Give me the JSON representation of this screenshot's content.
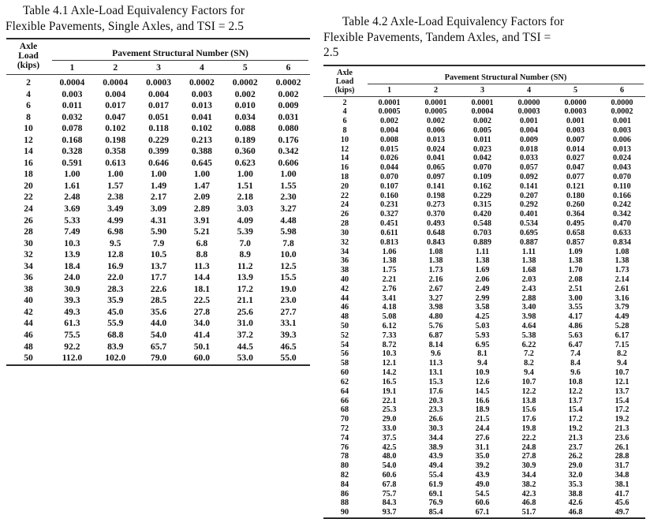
{
  "page": {
    "background_color": "#ffffff",
    "text_color": "#111111",
    "rule_color": "#2b2b2b"
  },
  "tables": [
    {
      "id": "table-4-1",
      "title_lines": [
        "Table 4.1  Axle-Load Equivalency Factors for",
        "Flexible Pavements, Single Axles, and TSI = 2.5"
      ],
      "stub_header_lines": [
        "Axle",
        "Load",
        "(kips)"
      ],
      "span_header": "Pavement Structural Number (SN)",
      "column_headers": [
        "1",
        "2",
        "3",
        "4",
        "5",
        "6"
      ],
      "rows": [
        {
          "load": "2",
          "values": [
            "0.0004",
            "0.0004",
            "0.0003",
            "0.0002",
            "0.0002",
            "0.0002"
          ]
        },
        {
          "load": "4",
          "values": [
            "0.003",
            "0.004",
            "0.004",
            "0.003",
            "0.002",
            "0.002"
          ]
        },
        {
          "load": "6",
          "values": [
            "0.011",
            "0.017",
            "0.017",
            "0.013",
            "0.010",
            "0.009"
          ]
        },
        {
          "load": "8",
          "values": [
            "0.032",
            "0.047",
            "0.051",
            "0.041",
            "0.034",
            "0.031"
          ]
        },
        {
          "load": "10",
          "values": [
            "0.078",
            "0.102",
            "0.118",
            "0.102",
            "0.088",
            "0.080"
          ]
        },
        {
          "load": "12",
          "values": [
            "0.168",
            "0.198",
            "0.229",
            "0.213",
            "0.189",
            "0.176"
          ]
        },
        {
          "load": "14",
          "values": [
            "0.328",
            "0.358",
            "0.399",
            "0.388",
            "0.360",
            "0.342"
          ]
        },
        {
          "load": "16",
          "values": [
            "0.591",
            "0.613",
            "0.646",
            "0.645",
            "0.623",
            "0.606"
          ]
        },
        {
          "load": "18",
          "values": [
            "1.00",
            "1.00",
            "1.00",
            "1.00",
            "1.00",
            "1.00"
          ]
        },
        {
          "load": "20",
          "values": [
            "1.61",
            "1.57",
            "1.49",
            "1.47",
            "1.51",
            "1.55"
          ]
        },
        {
          "load": "22",
          "values": [
            "2.48",
            "2.38",
            "2.17",
            "2.09",
            "2.18",
            "2.30"
          ]
        },
        {
          "load": "24",
          "values": [
            "3.69",
            "3.49",
            "3.09",
            "2.89",
            "3.03",
            "3.27"
          ]
        },
        {
          "load": "26",
          "values": [
            "5.33",
            "4.99",
            "4.31",
            "3.91",
            "4.09",
            "4.48"
          ]
        },
        {
          "load": "28",
          "values": [
            "7.49",
            "6.98",
            "5.90",
            "5.21",
            "5.39",
            "5.98"
          ]
        },
        {
          "load": "30",
          "values": [
            "10.3",
            "9.5",
            "7.9",
            "6.8",
            "7.0",
            "7.8"
          ]
        },
        {
          "load": "32",
          "values": [
            "13.9",
            "12.8",
            "10.5",
            "8.8",
            "8.9",
            "10.0"
          ]
        },
        {
          "load": "34",
          "values": [
            "18.4",
            "16.9",
            "13.7",
            "11.3",
            "11.2",
            "12.5"
          ]
        },
        {
          "load": "36",
          "values": [
            "24.0",
            "22.0",
            "17.7",
            "14.4",
            "13.9",
            "15.5"
          ]
        },
        {
          "load": "38",
          "values": [
            "30.9",
            "28.3",
            "22.6",
            "18.1",
            "17.2",
            "19.0"
          ]
        },
        {
          "load": "40",
          "values": [
            "39.3",
            "35.9",
            "28.5",
            "22.5",
            "21.1",
            "23.0"
          ]
        },
        {
          "load": "42",
          "values": [
            "49.3",
            "45.0",
            "35.6",
            "27.8",
            "25.6",
            "27.7"
          ]
        },
        {
          "load": "44",
          "values": [
            "61.3",
            "55.9",
            "44.0",
            "34.0",
            "31.0",
            "33.1"
          ]
        },
        {
          "load": "46",
          "values": [
            "75.5",
            "68.8",
            "54.0",
            "41.4",
            "37.2",
            "39.3"
          ]
        },
        {
          "load": "48",
          "values": [
            "92.2",
            "83.9",
            "65.7",
            "50.1",
            "44.5",
            "46.5"
          ]
        },
        {
          "load": "50",
          "values": [
            "112.0",
            "102.0",
            "79.0",
            "60.0",
            "53.0",
            "55.0"
          ]
        }
      ]
    },
    {
      "id": "table-4-2",
      "title_lines": [
        "Table 4.2  Axle-Load Equivalency Factors for",
        "Flexible Pavements, Tandem Axles, and TSI =",
        "2.5"
      ],
      "stub_header_lines": [
        "Axle",
        "Load",
        "(kips)"
      ],
      "span_header": "Pavement Structural Number (SN)",
      "column_headers": [
        "1",
        "2",
        "3",
        "4",
        "5",
        "6"
      ],
      "rows": [
        {
          "load": "2",
          "values": [
            "0.0001",
            "0.0001",
            "0.0001",
            "0.0000",
            "0.0000",
            "0.0000"
          ]
        },
        {
          "load": "4",
          "values": [
            "0.0005",
            "0.0005",
            "0.0004",
            "0.0003",
            "0.0003",
            "0.0002"
          ]
        },
        {
          "load": "6",
          "values": [
            "0.002",
            "0.002",
            "0.002",
            "0.001",
            "0.001",
            "0.001"
          ]
        },
        {
          "load": "8",
          "values": [
            "0.004",
            "0.006",
            "0.005",
            "0.004",
            "0.003",
            "0.003"
          ]
        },
        {
          "load": "10",
          "values": [
            "0.008",
            "0.013",
            "0.011",
            "0.009",
            "0.007",
            "0.006"
          ]
        },
        {
          "load": "12",
          "values": [
            "0.015",
            "0.024",
            "0.023",
            "0.018",
            "0.014",
            "0.013"
          ]
        },
        {
          "load": "14",
          "values": [
            "0.026",
            "0.041",
            "0.042",
            "0.033",
            "0.027",
            "0.024"
          ]
        },
        {
          "load": "16",
          "values": [
            "0.044",
            "0.065",
            "0.070",
            "0.057",
            "0.047",
            "0.043"
          ]
        },
        {
          "load": "18",
          "values": [
            "0.070",
            "0.097",
            "0.109",
            "0.092",
            "0.077",
            "0.070"
          ]
        },
        {
          "load": "20",
          "values": [
            "0.107",
            "0.141",
            "0.162",
            "0.141",
            "0.121",
            "0.110"
          ]
        },
        {
          "load": "22",
          "values": [
            "0.160",
            "0.198",
            "0.229",
            "0.207",
            "0.180",
            "0.166"
          ]
        },
        {
          "load": "24",
          "values": [
            "0.231",
            "0.273",
            "0.315",
            "0.292",
            "0.260",
            "0.242"
          ]
        },
        {
          "load": "26",
          "values": [
            "0.327",
            "0.370",
            "0.420",
            "0.401",
            "0.364",
            "0.342"
          ]
        },
        {
          "load": "28",
          "values": [
            "0.451",
            "0.493",
            "0.548",
            "0.534",
            "0.495",
            "0.470"
          ]
        },
        {
          "load": "30",
          "values": [
            "0.611",
            "0.648",
            "0.703",
            "0.695",
            "0.658",
            "0.633"
          ]
        },
        {
          "load": "32",
          "values": [
            "0.813",
            "0.843",
            "0.889",
            "0.887",
            "0.857",
            "0.834"
          ]
        },
        {
          "load": "34",
          "values": [
            "1.06",
            "1.08",
            "1.11",
            "1.11",
            "1.09",
            "1.08"
          ]
        },
        {
          "load": "36",
          "values": [
            "1.38",
            "1.38",
            "1.38",
            "1.38",
            "1.38",
            "1.38"
          ]
        },
        {
          "load": "38",
          "values": [
            "1.75",
            "1.73",
            "1.69",
            "1.68",
            "1.70",
            "1.73"
          ]
        },
        {
          "load": "40",
          "values": [
            "2.21",
            "2.16",
            "2.06",
            "2.03",
            "2.08",
            "2.14"
          ]
        },
        {
          "load": "42",
          "values": [
            "2.76",
            "2.67",
            "2.49",
            "2.43",
            "2.51",
            "2.61"
          ]
        },
        {
          "load": "44",
          "values": [
            "3.41",
            "3.27",
            "2.99",
            "2.88",
            "3.00",
            "3.16"
          ]
        },
        {
          "load": "46",
          "values": [
            "4.18",
            "3.98",
            "3.58",
            "3.40",
            "3.55",
            "3.79"
          ]
        },
        {
          "load": "48",
          "values": [
            "5.08",
            "4.80",
            "4.25",
            "3.98",
            "4.17",
            "4.49"
          ]
        },
        {
          "load": "50",
          "values": [
            "6.12",
            "5.76",
            "5.03",
            "4.64",
            "4.86",
            "5.28"
          ]
        },
        {
          "load": "52",
          "values": [
            "7.33",
            "6.87",
            "5.93",
            "5.38",
            "5.63",
            "6.17"
          ]
        },
        {
          "load": "54",
          "values": [
            "8.72",
            "8.14",
            "6.95",
            "6.22",
            "6.47",
            "7.15"
          ]
        },
        {
          "load": "56",
          "values": [
            "10.3",
            "9.6",
            "8.1",
            "7.2",
            "7.4",
            "8.2"
          ]
        },
        {
          "load": "58",
          "values": [
            "12.1",
            "11.3",
            "9.4",
            "8.2",
            "8.4",
            "9.4"
          ]
        },
        {
          "load": "60",
          "values": [
            "14.2",
            "13.1",
            "10.9",
            "9.4",
            "9.6",
            "10.7"
          ]
        },
        {
          "load": "62",
          "values": [
            "16.5",
            "15.3",
            "12.6",
            "10.7",
            "10.8",
            "12.1"
          ]
        },
        {
          "load": "64",
          "values": [
            "19.1",
            "17.6",
            "14.5",
            "12.2",
            "12.2",
            "13.7"
          ]
        },
        {
          "load": "66",
          "values": [
            "22.1",
            "20.3",
            "16.6",
            "13.8",
            "13.7",
            "15.4"
          ]
        },
        {
          "load": "68",
          "values": [
            "25.3",
            "23.3",
            "18.9",
            "15.6",
            "15.4",
            "17.2"
          ]
        },
        {
          "load": "70",
          "values": [
            "29.0",
            "26.6",
            "21.5",
            "17.6",
            "17.2",
            "19.2"
          ]
        },
        {
          "load": "72",
          "values": [
            "33.0",
            "30.3",
            "24.4",
            "19.8",
            "19.2",
            "21.3"
          ]
        },
        {
          "load": "74",
          "values": [
            "37.5",
            "34.4",
            "27.6",
            "22.2",
            "21.3",
            "23.6"
          ]
        },
        {
          "load": "76",
          "values": [
            "42.5",
            "38.9",
            "31.1",
            "24.8",
            "23.7",
            "26.1"
          ]
        },
        {
          "load": "78",
          "values": [
            "48.0",
            "43.9",
            "35.0",
            "27.8",
            "26.2",
            "28.8"
          ]
        },
        {
          "load": "80",
          "values": [
            "54.0",
            "49.4",
            "39.2",
            "30.9",
            "29.0",
            "31.7"
          ]
        },
        {
          "load": "82",
          "values": [
            "60.6",
            "55.4",
            "43.9",
            "34.4",
            "32.0",
            "34.8"
          ]
        },
        {
          "load": "84",
          "values": [
            "67.8",
            "61.9",
            "49.0",
            "38.2",
            "35.3",
            "38.1"
          ]
        },
        {
          "load": "86",
          "values": [
            "75.7",
            "69.1",
            "54.5",
            "42.3",
            "38.8",
            "41.7"
          ]
        },
        {
          "load": "88",
          "values": [
            "84.3",
            "76.9",
            "60.6",
            "46.8",
            "42.6",
            "45.6"
          ]
        },
        {
          "load": "90",
          "values": [
            "93.7",
            "85.4",
            "67.1",
            "51.7",
            "46.8",
            "49.7"
          ]
        }
      ]
    }
  ]
}
